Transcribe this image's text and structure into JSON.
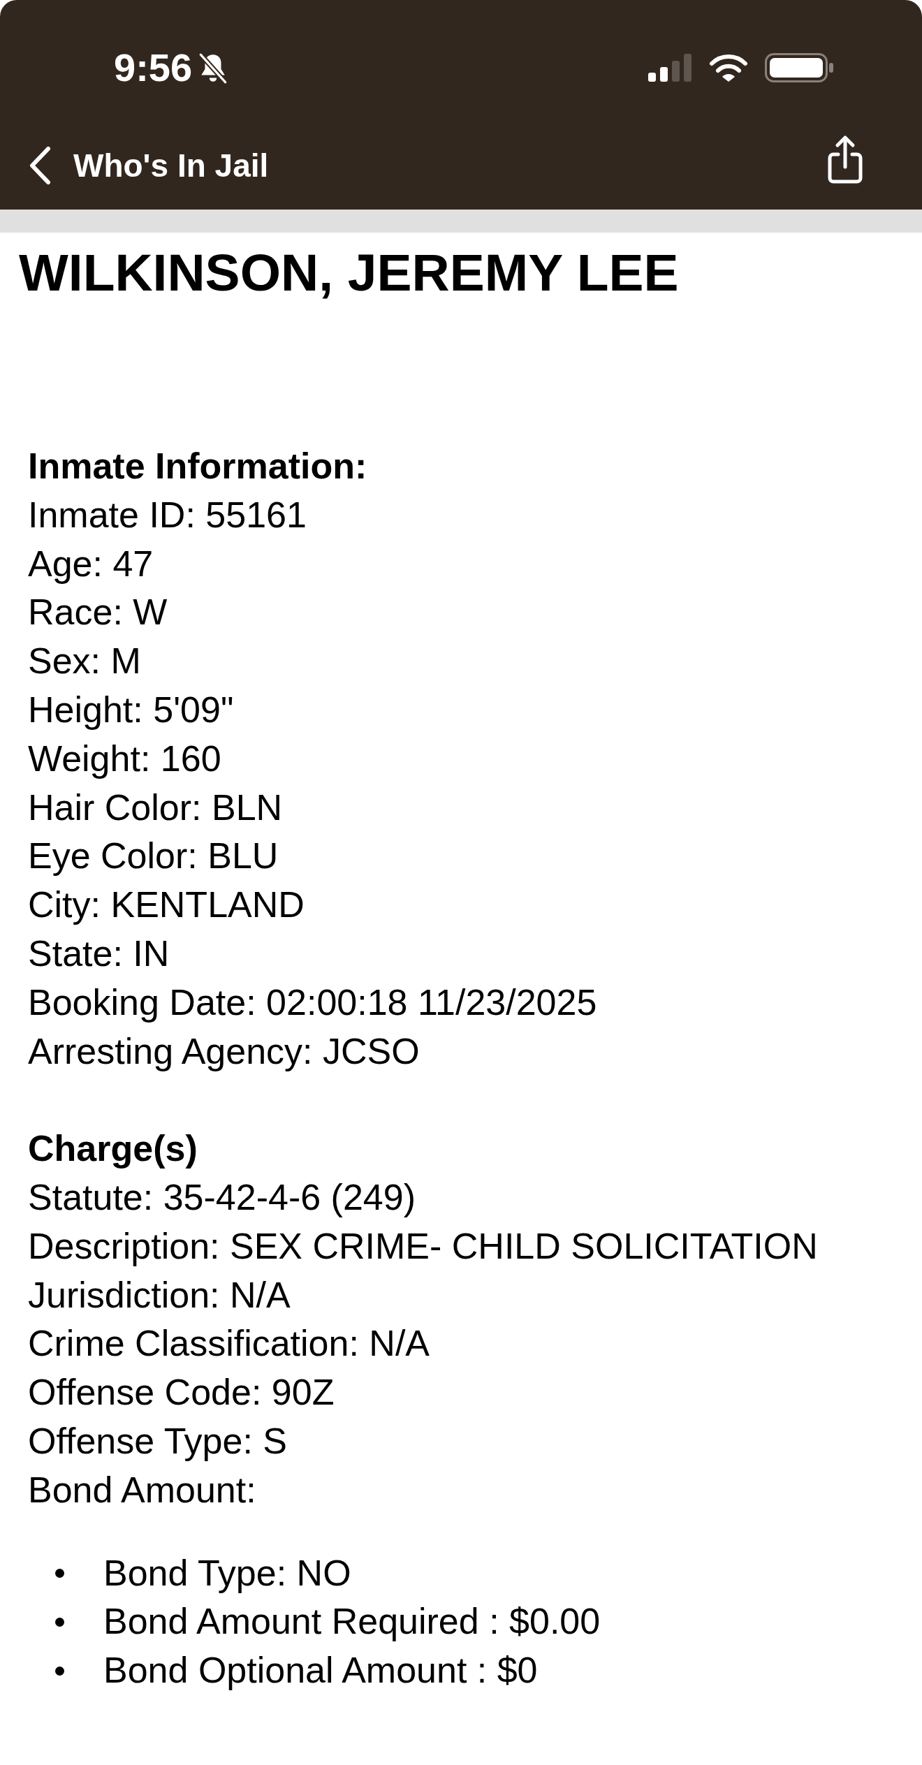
{
  "status_bar": {
    "time": "9:56",
    "silent": true
  },
  "nav": {
    "back_label": "Who's In Jail"
  },
  "title": "WILKINSON, JEREMY LEE",
  "sections": [
    {
      "heading": "Inmate Information:",
      "lines": [
        "Inmate ID: 55161",
        "Age: 47",
        "Race: W",
        "Sex: M",
        "Height: 5'09\"",
        "Weight: 160",
        "Hair Color: BLN",
        "Eye Color: BLU",
        "City: KENTLAND",
        "State: IN",
        "Booking Date: 02:00:18 11/23/2025",
        "Arresting Agency: JCSO"
      ]
    },
    {
      "heading": "Charge(s)",
      "lines": [
        "Statute: 35-42-4-6 (249)",
        "Description: SEX CRIME- CHILD SOLICITATION",
        "Jurisdiction: N/A",
        "Crime Classification: N/A",
        "Offense Code: 90Z",
        "Offense Type: S",
        "Bond Amount:"
      ],
      "bullets": [
        "Bond Type: NO",
        "Bond Amount Required : $0.00",
        "Bond Optional Amount : $0"
      ]
    }
  ]
}
